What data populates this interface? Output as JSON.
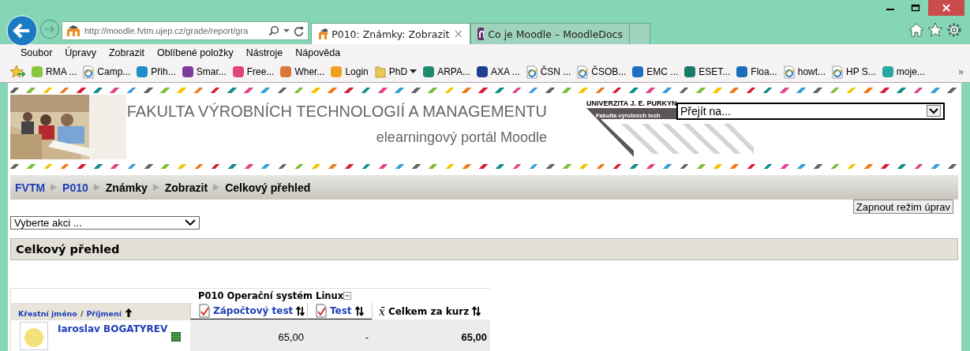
{
  "browser": {
    "address": "http://moodle.fvtm.ujep.cz/grade/report/gra",
    "tabs": [
      {
        "label": "P010: Známky: Zobrazit",
        "selected": true,
        "close": "×",
        "kind": "moodle"
      },
      {
        "label": "Co je Moodle – MoodleDocs",
        "selected": false,
        "kind": "docs"
      }
    ],
    "menu": [
      "Soubor",
      "Úpravy",
      "Zobrazit",
      "Oblíbené položky",
      "Nástroje",
      "Nápověda"
    ],
    "favorites": [
      {
        "label": "RMA ...",
        "kind": "logo",
        "color": "#8cc63f"
      },
      {
        "label": "Camp...",
        "kind": "page"
      },
      {
        "label": "Přih...",
        "kind": "logo",
        "color": "#1a8fc9"
      },
      {
        "label": "Smar...",
        "kind": "logo",
        "color": "#7d3c98"
      },
      {
        "label": "Free...",
        "kind": "logo",
        "color": "#e0457b"
      },
      {
        "label": "Wher...",
        "kind": "logo",
        "color": "#d9763a"
      },
      {
        "label": "Login",
        "kind": "logo",
        "color": "#f0a020"
      },
      {
        "label": "PhD",
        "kind": "folder"
      },
      {
        "label": "ARPA...",
        "kind": "logo",
        "color": "#1e8a6e"
      },
      {
        "label": "AXA ...",
        "kind": "logo",
        "color": "#1f3f8f"
      },
      {
        "label": "ČSN ...",
        "kind": "page"
      },
      {
        "label": "ČSOB...",
        "kind": "page"
      },
      {
        "label": "EMC ...",
        "kind": "logo",
        "color": "#1e6fc0"
      },
      {
        "label": "ESET...",
        "kind": "logo",
        "color": "#1a7a6a"
      },
      {
        "label": "Floa...",
        "kind": "logo",
        "color": "#1a6fb8"
      },
      {
        "label": "howt...",
        "kind": "page"
      },
      {
        "label": "HP S...",
        "kind": "page"
      },
      {
        "label": "moje...",
        "kind": "logo",
        "color": "#2aa6a0"
      }
    ],
    "more": "»"
  },
  "header": {
    "title": "FAKULTA VÝROBNÍCH TECHNOLOGIÍ A MANAGEMENTU",
    "subtitle": "elearningový portál Moodle",
    "logo_line_1": "UNIVERZITA J. E. PURKYN",
    "logo_line_2": "Fakulta výrobních tech",
    "jump": "Přejít na..."
  },
  "breadcrumb": [
    {
      "label": "FVTM",
      "link": true
    },
    {
      "label": "P010",
      "link": true
    },
    {
      "label": "Známky",
      "link": false
    },
    {
      "label": "Zobrazit",
      "link": false
    },
    {
      "label": "Celkový přehled",
      "link": false
    }
  ],
  "edit_button": "Zapnout režim úprav",
  "action_select": "Vyberte akci ...",
  "heading": "Celkový přehled",
  "grader": {
    "category": "P010 Operační systém Linux",
    "name_sort": {
      "first": "Křestní jméno",
      "separator": "/",
      "last": "Příjmení"
    },
    "columns": [
      {
        "label": "Zápočtový test",
        "kind": "quiz"
      },
      {
        "label": "Test",
        "kind": "quiz"
      },
      {
        "label": "Celkem za kurz",
        "kind": "total",
        "symbol": "x̄"
      }
    ],
    "rows": [
      {
        "name": "Iaroslav BOGATYREV",
        "grades": [
          "65,00",
          "-",
          "65,00"
        ]
      }
    ]
  }
}
